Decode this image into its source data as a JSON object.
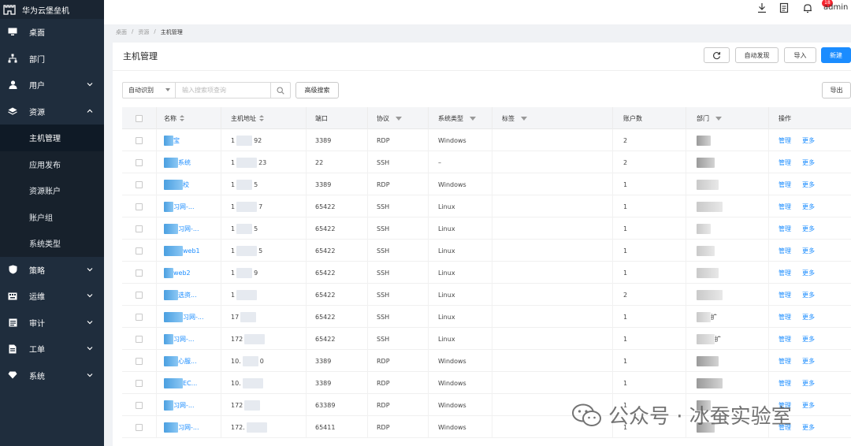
{
  "app": {
    "title": "华为云堡垒机",
    "user": "admin",
    "notification_count": "18"
  },
  "sidebar": {
    "items": [
      {
        "label": "桌面",
        "icon": "monitor-icon"
      },
      {
        "label": "部门",
        "icon": "org-tree-icon"
      },
      {
        "label": "用户",
        "icon": "user-icon",
        "has_children": true
      },
      {
        "label": "资源",
        "icon": "layers-icon",
        "expanded": true
      },
      {
        "label": "策略",
        "icon": "shield-icon",
        "has_children": true
      },
      {
        "label": "运维",
        "icon": "keyboard-icon",
        "has_children": true
      },
      {
        "label": "审计",
        "icon": "calendar-icon",
        "has_children": true
      },
      {
        "label": "工单",
        "icon": "document-icon",
        "has_children": true
      },
      {
        "label": "系统",
        "icon": "diamond-icon",
        "has_children": true
      }
    ],
    "resource_children": [
      "主机管理",
      "应用发布",
      "资源账户",
      "账户组",
      "系统类型"
    ],
    "active_child": "主机管理"
  },
  "breadcrumb": [
    "桌面",
    "资源",
    "主机管理"
  ],
  "page": {
    "title": "主机管理",
    "refresh_icon": "refresh-icon",
    "auto_discover": "自动发现",
    "import": "导入",
    "new": "新建",
    "export": "导出"
  },
  "search": {
    "mode": "自动识别",
    "placeholder": "输入搜索项查询",
    "advanced": "高级搜索"
  },
  "table": {
    "headers": [
      "名称",
      "主机地址",
      "端口",
      "协议",
      "系统类型",
      "标签",
      "账户数",
      "部门",
      "操作"
    ],
    "rows": [
      {
        "name": "宝",
        "addr_start": "1",
        "addr_end": "92",
        "port": "3389",
        "protocol": "RDP",
        "os": "Windows",
        "tag": "",
        "accounts": "2",
        "dept": "",
        "manage": "管理",
        "more": "更多"
      },
      {
        "name": "系统",
        "addr_start": "1",
        "addr_end": "23",
        "port": "22",
        "protocol": "SSH",
        "os": "–",
        "tag": "",
        "accounts": "2",
        "dept": "",
        "manage": "管理",
        "more": "更多"
      },
      {
        "name": "校",
        "addr_start": "1",
        "addr_end": "5",
        "port": "3389",
        "protocol": "RDP",
        "os": "Windows",
        "tag": "",
        "accounts": "1",
        "dept": "",
        "manage": "管理",
        "more": "更多"
      },
      {
        "name": "习网-...",
        "addr_start": "1",
        "addr_end": "7",
        "port": "65422",
        "protocol": "SSH",
        "os": "Linux",
        "tag": "",
        "accounts": "1",
        "dept": "",
        "manage": "管理",
        "more": "更多"
      },
      {
        "name": "习网-...",
        "addr_start": "1",
        "addr_end": "5",
        "port": "65422",
        "protocol": "SSH",
        "os": "Linux",
        "tag": "",
        "accounts": "1",
        "dept": "",
        "manage": "管理",
        "more": "更多"
      },
      {
        "name": "web1",
        "addr_start": "1",
        "addr_end": "5",
        "port": "65422",
        "protocol": "SSH",
        "os": "Linux",
        "tag": "",
        "accounts": "1",
        "dept": "",
        "manage": "管理",
        "more": "更多"
      },
      {
        "name": "web2",
        "addr_start": "1",
        "addr_end": "9",
        "port": "65422",
        "protocol": "SSH",
        "os": "Linux",
        "tag": "",
        "accounts": "1",
        "dept": "",
        "manage": "管理",
        "more": "更多"
      },
      {
        "name": "选资...",
        "addr_start": "1",
        "addr_end": "",
        "port": "65422",
        "protocol": "SSH",
        "os": "Linux",
        "tag": "",
        "accounts": "2",
        "dept": "",
        "manage": "管理",
        "more": "更多"
      },
      {
        "name": "习网-...",
        "addr_start": "17",
        "addr_end": "",
        "port": "65422",
        "protocol": "SSH",
        "os": "Linux",
        "tag": "",
        "accounts": "1",
        "dept": "扩",
        "manage": "管理",
        "more": "更多"
      },
      {
        "name": "习网-...",
        "addr_start": "172",
        "addr_end": "",
        "port": "65422",
        "protocol": "SSH",
        "os": "Linux",
        "tag": "",
        "accounts": "1",
        "dept": "扩",
        "manage": "管理",
        "more": "更多"
      },
      {
        "name": "心服...",
        "addr_start": "10.",
        "addr_end": "0",
        "port": "3389",
        "protocol": "RDP",
        "os": "Windows",
        "tag": "",
        "accounts": "1",
        "dept": "",
        "manage": "管理",
        "more": "更多"
      },
      {
        "name": "EC...",
        "addr_start": "10.",
        "addr_end": "",
        "port": "3389",
        "protocol": "RDP",
        "os": "Windows",
        "tag": "",
        "accounts": "1",
        "dept": "",
        "manage": "管理",
        "more": "更多"
      },
      {
        "name": "习网-...",
        "addr_start": "172",
        "addr_end": "",
        "port": "63389",
        "protocol": "RDP",
        "os": "Windows",
        "tag": "",
        "accounts": "1",
        "dept": "",
        "manage": "管理",
        "more": "更多"
      },
      {
        "name": "习网-...",
        "addr_start": "172.",
        "addr_end": "",
        "port": "65411",
        "protocol": "RDP",
        "os": "Windows",
        "tag": "",
        "accounts": "1",
        "dept": "",
        "manage": "管理",
        "more": "更多"
      }
    ]
  },
  "watermark": {
    "text": "公众号 · 冰蚕实验室"
  },
  "colors": {
    "sidebar_bg": "#1f2d3d",
    "primary": "#1a8cff",
    "badge": "#f5222d"
  }
}
